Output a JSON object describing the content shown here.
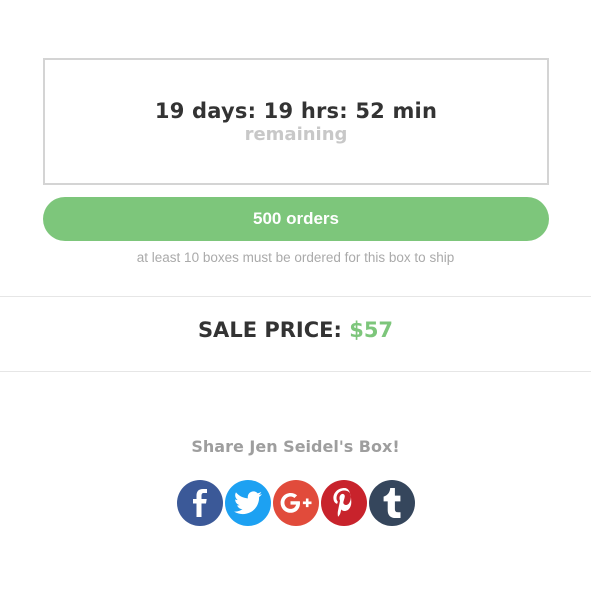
{
  "countdown": {
    "time_text": "19 days: 19 hrs: 52 min",
    "sub_text": "remaining"
  },
  "orders": {
    "label": "500 orders",
    "color": "#7dc67b"
  },
  "ship_note": "at least 10 boxes must be ordered for this box to ship",
  "price": {
    "label": "SALE PRICE:",
    "value": "$57"
  },
  "share": {
    "title": "Share Jen Seidel's Box!",
    "buttons": [
      {
        "icon": "facebook-icon",
        "color": "#3b5998"
      },
      {
        "icon": "twitter-icon",
        "color": "#1da1f2"
      },
      {
        "icon": "google-plus-icon",
        "color": "#e14b3b"
      },
      {
        "icon": "pinterest-icon",
        "color": "#c8232c"
      },
      {
        "icon": "tumblr-icon",
        "color": "#35465c"
      }
    ]
  }
}
